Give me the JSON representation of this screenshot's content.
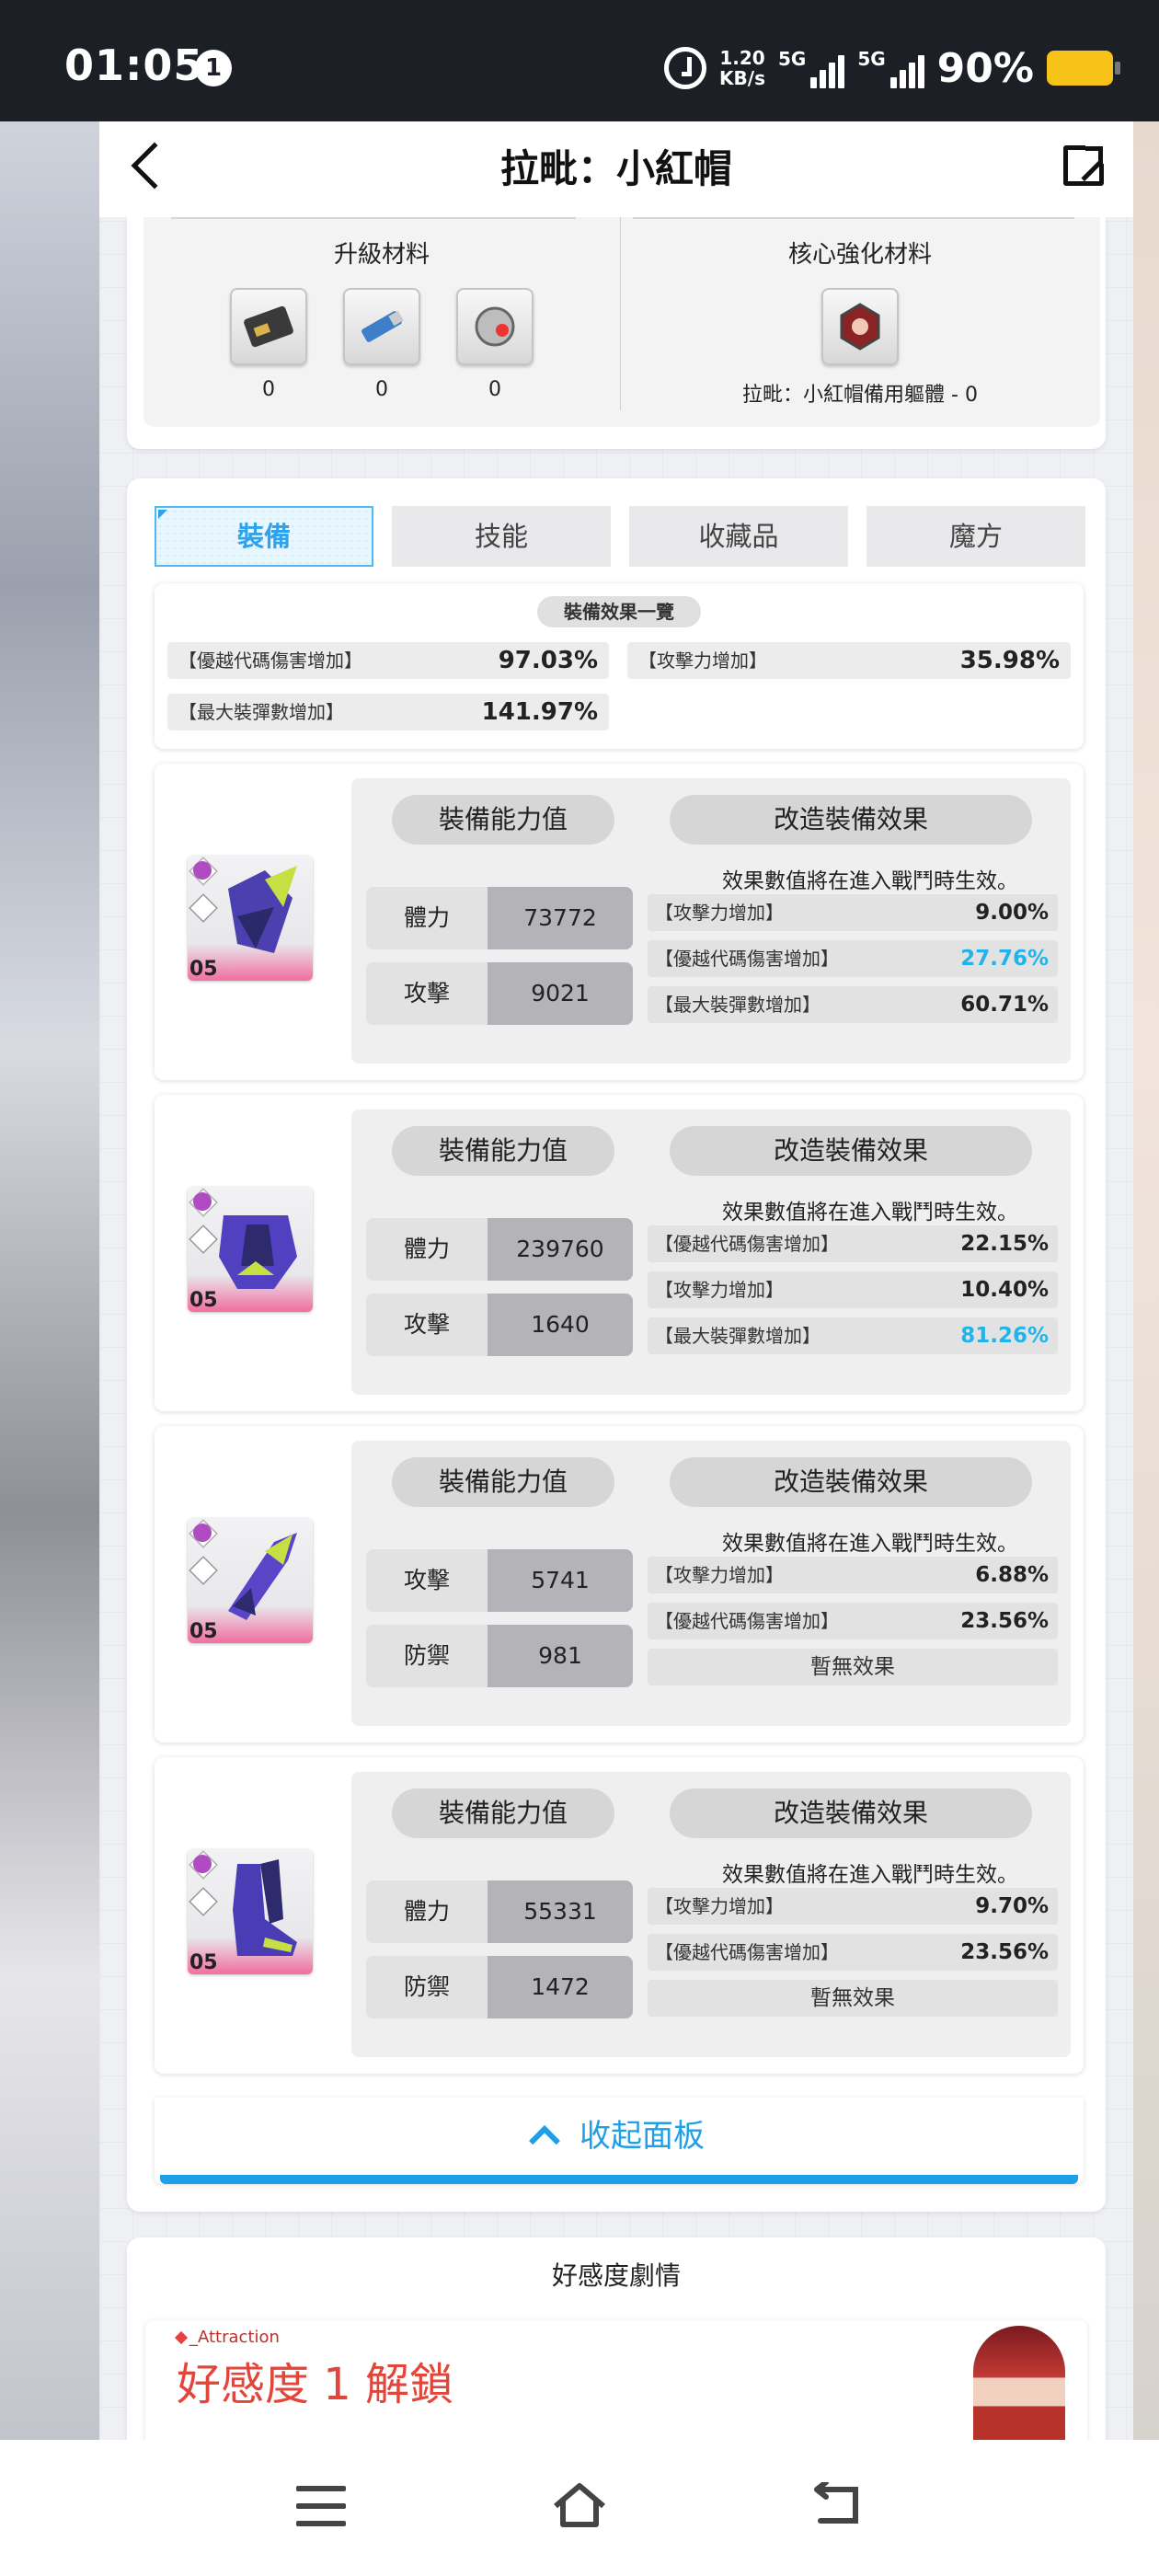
{
  "status_bar": {
    "time": "01:05",
    "notification_count": "1",
    "net_speed_value": "1.20",
    "net_speed_unit": "KB/s",
    "sim1_label": "5G",
    "sim2_label": "5G",
    "battery_percent": "90%",
    "battery_color": "#f7c318"
  },
  "header": {
    "title": "拉毗：小紅帽",
    "back_icon": "chevron-left-icon",
    "share_icon": "external-link-icon"
  },
  "materials": {
    "upgrade_title": "升級材料",
    "upgrade_items": [
      {
        "icon": "card-chip-icon",
        "count": "0"
      },
      {
        "icon": "usb-drive-icon",
        "count": "0"
      },
      {
        "icon": "core-orb-icon",
        "count": "0"
      }
    ],
    "core_title": "核心強化材料",
    "core_item": {
      "icon": "character-core-icon",
      "label": "拉毗：小紅帽備用軀體 - 0"
    }
  },
  "tabs": [
    {
      "label": "裝備",
      "active": true
    },
    {
      "label": "技能",
      "active": false
    },
    {
      "label": "收藏品",
      "active": false
    },
    {
      "label": "魔方",
      "active": false
    }
  ],
  "summary": {
    "title": "裝備效果一覽",
    "rows": [
      {
        "key": "【優越代碼傷害增加】",
        "value": "97.03%"
      },
      {
        "key": "【攻擊力增加】",
        "value": "35.98%"
      },
      {
        "key": "【最大裝彈數增加】",
        "value": "141.97%"
      }
    ]
  },
  "equipment_common": {
    "stats_title": "裝備能力值",
    "effects_title": "改造裝備效果",
    "effects_note": "效果數值將在進入戰鬥時生效。",
    "no_effect": "暫無效果",
    "highlight_color": "#22b3e8"
  },
  "equipment": [
    {
      "level": "05",
      "icon": "helmet-gear-icon",
      "stats": [
        {
          "label": "體力",
          "value": "73772"
        },
        {
          "label": "攻擊",
          "value": "9021"
        }
      ],
      "effects": [
        {
          "key": "【攻擊力增加】",
          "value": "9.00%",
          "highlight": false
        },
        {
          "key": "【優越代碼傷害增加】",
          "value": "27.76%",
          "highlight": true
        },
        {
          "key": "【最大裝彈數增加】",
          "value": "60.71%",
          "highlight": false
        }
      ]
    },
    {
      "level": "05",
      "icon": "armor-gear-icon",
      "stats": [
        {
          "label": "體力",
          "value": "239760"
        },
        {
          "label": "攻擊",
          "value": "1640"
        }
      ],
      "effects": [
        {
          "key": "【優越代碼傷害增加】",
          "value": "22.15%",
          "highlight": false
        },
        {
          "key": "【攻擊力增加】",
          "value": "10.40%",
          "highlight": false
        },
        {
          "key": "【最大裝彈數增加】",
          "value": "81.26%",
          "highlight": true
        }
      ]
    },
    {
      "level": "05",
      "icon": "gauntlet-gear-icon",
      "stats": [
        {
          "label": "攻擊",
          "value": "5741"
        },
        {
          "label": "防禦",
          "value": "981"
        }
      ],
      "effects": [
        {
          "key": "【攻擊力增加】",
          "value": "6.88%",
          "highlight": false
        },
        {
          "key": "【優越代碼傷害增加】",
          "value": "23.56%",
          "highlight": false
        }
      ]
    },
    {
      "level": "05",
      "icon": "boots-gear-icon",
      "stats": [
        {
          "label": "體力",
          "value": "55331"
        },
        {
          "label": "防禦",
          "value": "1472"
        }
      ],
      "effects": [
        {
          "key": "【攻擊力增加】",
          "value": "9.70%",
          "highlight": false
        },
        {
          "key": "【優越代碼傷害增加】",
          "value": "23.56%",
          "highlight": false
        }
      ]
    }
  ],
  "collapse": {
    "label": "收起面板",
    "icon": "chevron-up-icon",
    "color": "#1f9fe8"
  },
  "attraction": {
    "section_title": "好感度劇情",
    "small_label": "_Attraction",
    "big_label": "好感度 1 解鎖"
  },
  "nav": {
    "menu_icon": "menu-icon",
    "home_icon": "home-icon",
    "back_icon": "back-icon"
  }
}
